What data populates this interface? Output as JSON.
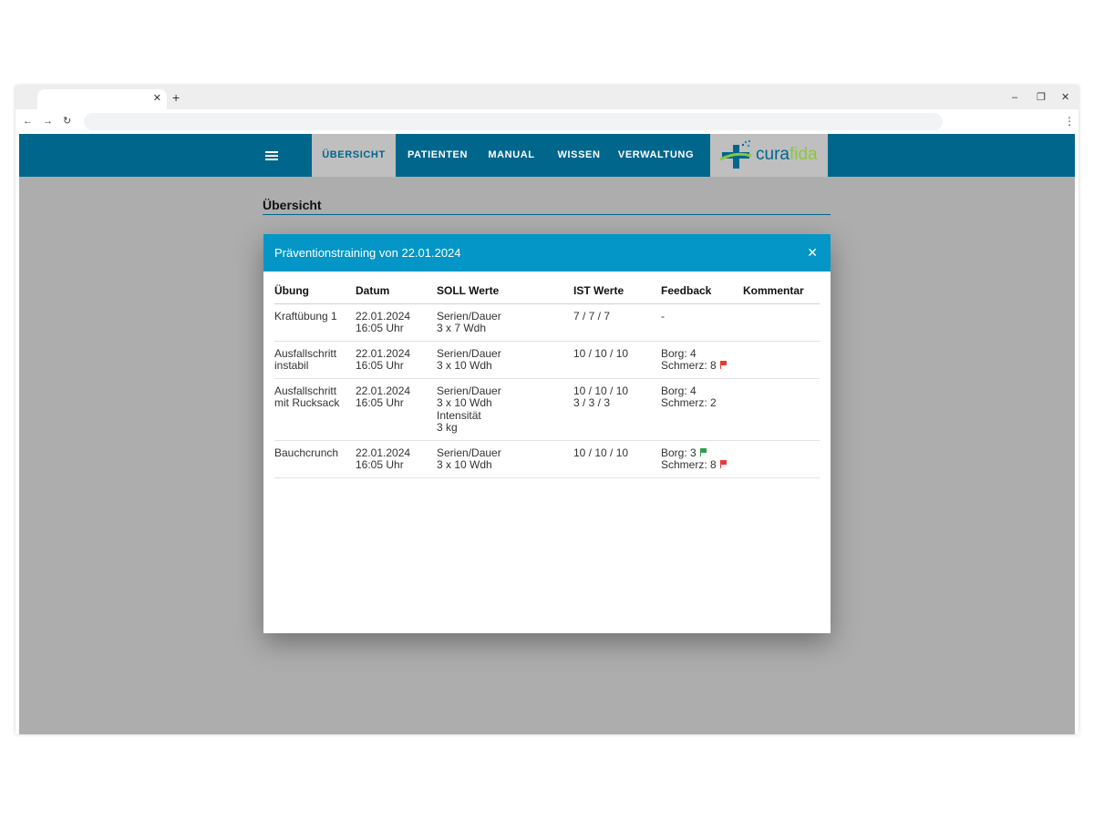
{
  "browser": {
    "tab_close_icon": "✕",
    "new_tab_icon": "+",
    "minimize_icon": "–",
    "restore_icon": "❐",
    "close_icon": "✕",
    "back_icon": "←",
    "forward_icon": "→",
    "reload_icon": "↻",
    "menu_icon": "⋮"
  },
  "appbar": {
    "background": "#00668c",
    "nav": [
      "ÜBERSICHT",
      "PATIENTEN",
      "MANUAL",
      "WISSEN",
      "VERWALTUNG"
    ],
    "logo": {
      "part1": "cura",
      "part2": "fida"
    }
  },
  "page": {
    "title": "Übersicht"
  },
  "dialog": {
    "title": "Präventionstraining von 22.01.2024",
    "close_icon": "✕",
    "header_color": "#0396c6",
    "columns": [
      "Übung",
      "Datum",
      "SOLL Werte",
      "IST Werte",
      "Feedback",
      "Kommentar"
    ],
    "rows": [
      {
        "uebung": [
          "Kraftübung 1"
        ],
        "datum": [
          "22.01.2024",
          "16:05 Uhr"
        ],
        "soll": [
          "Serien/Dauer",
          "3 x 7 Wdh"
        ],
        "ist": [
          "7 / 7 / 7"
        ],
        "feedback": [
          {
            "text": "-",
            "flag": null
          }
        ],
        "kommentar": ""
      },
      {
        "uebung": [
          "Ausfallschritt",
          "instabil"
        ],
        "datum": [
          "22.01.2024",
          "16:05 Uhr"
        ],
        "soll": [
          "Serien/Dauer",
          "3 x 10 Wdh"
        ],
        "ist": [
          "10 / 10 / 10"
        ],
        "feedback": [
          {
            "text": "Borg: 4",
            "flag": null
          },
          {
            "text": "Schmerz: 8",
            "flag": "red"
          }
        ],
        "kommentar": ""
      },
      {
        "uebung": [
          "Ausfallschritt",
          "mit Rucksack"
        ],
        "datum": [
          "22.01.2024",
          "16:05 Uhr"
        ],
        "soll": [
          "Serien/Dauer",
          "3 x 10 Wdh",
          "Intensität",
          "3 kg"
        ],
        "ist": [
          "10 / 10 / 10",
          "3 / 3 / 3"
        ],
        "feedback": [
          {
            "text": "Borg: 4",
            "flag": null
          },
          {
            "text": "Schmerz: 2",
            "flag": null
          }
        ],
        "kommentar": ""
      },
      {
        "uebung": [
          "Bauchcrunch"
        ],
        "datum": [
          "22.01.2024",
          "16:05 Uhr"
        ],
        "soll": [
          "Serien/Dauer",
          "3 x 10 Wdh"
        ],
        "ist": [
          "10 / 10 / 10"
        ],
        "feedback": [
          {
            "text": "Borg: 3",
            "flag": "green"
          },
          {
            "text": "Schmerz: 8",
            "flag": "red"
          }
        ],
        "kommentar": ""
      }
    ],
    "flag_colors": {
      "red": "#e53935",
      "green": "#2e9e4f"
    }
  }
}
